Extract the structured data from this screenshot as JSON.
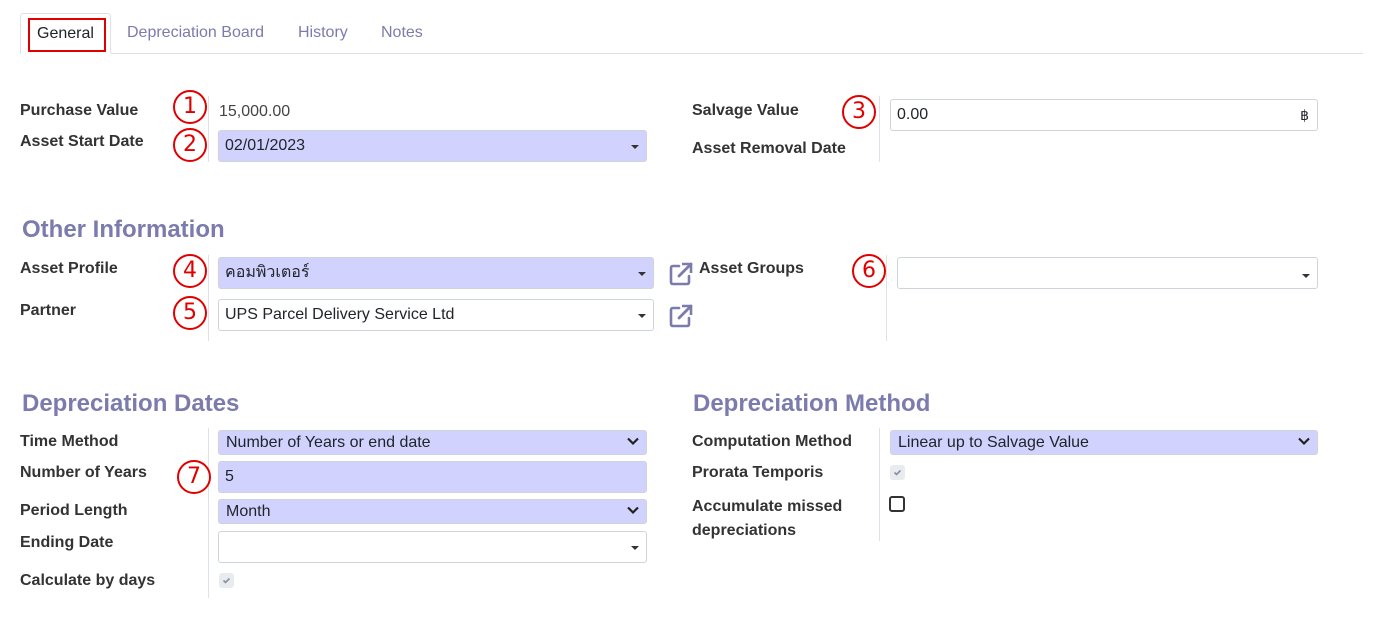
{
  "tabs": [
    {
      "label": "General"
    },
    {
      "label": "Depreciation Board"
    },
    {
      "label": "History"
    },
    {
      "label": "Notes"
    }
  ],
  "top": {
    "purchase_value_label": "Purchase Value",
    "purchase_value": "15,000.00",
    "asset_start_date_label": "Asset Start Date",
    "asset_start_date": "02/01/2023",
    "salvage_value_label": "Salvage Value",
    "salvage_value": "0.00",
    "currency_symbol": "฿",
    "asset_removal_date_label": "Asset Removal Date"
  },
  "other_info": {
    "title": "Other Information",
    "asset_profile_label": "Asset Profile",
    "asset_profile": "คอมพิวเตอร์",
    "partner_label": "Partner",
    "partner": "UPS Parcel Delivery Service Ltd",
    "asset_groups_label": "Asset Groups",
    "asset_groups": ""
  },
  "dates": {
    "title": "Depreciation Dates",
    "time_method_label": "Time Method",
    "time_method": "Number of Years or end date",
    "number_of_years_label": "Number of Years",
    "number_of_years": "5",
    "period_length_label": "Period Length",
    "period_length": "Month",
    "ending_date_label": "Ending Date",
    "ending_date": "",
    "calculate_by_days_label": "Calculate by days",
    "calculate_by_days": true
  },
  "method": {
    "title": "Depreciation Method",
    "computation_method_label": "Computation Method",
    "computation_method": "Linear up to Salvage Value",
    "prorata_temporis_label": "Prorata Temporis",
    "prorata_temporis": true,
    "accumulate_label_line1": "Accumulate missed",
    "accumulate_label_line2": "depreciations",
    "accumulate_missed": false
  },
  "annotations": [
    "1",
    "2",
    "3",
    "4",
    "5",
    "6",
    "7"
  ],
  "colors": {
    "accent": "#7c7bad",
    "required_bg": "#d2d2ff",
    "annotation": "#e00000"
  }
}
